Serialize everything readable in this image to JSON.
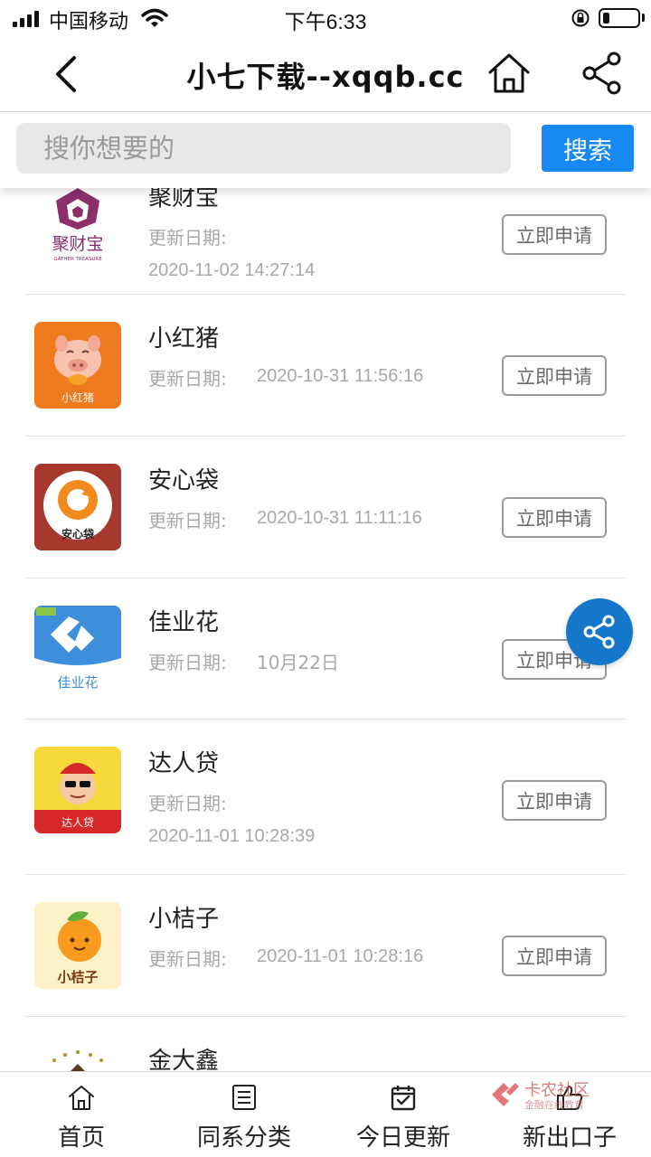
{
  "status_bar": {
    "carrier": "中国移动",
    "time": "下午6:33"
  },
  "nav": {
    "title": "小七下载--xqqb.cc",
    "back_icon": "chevron-left-icon",
    "home_icon": "home-icon",
    "share_icon": "share-icon"
  },
  "search": {
    "placeholder": "搜你想要的",
    "value": "",
    "button_label": "搜索"
  },
  "items": [
    {
      "name": "聚财宝",
      "date_label": "更新日期:",
      "date": "2020-11-02 14:27:14",
      "button": "立即申请",
      "icon_text": "聚财宝",
      "icon_subtext": "GATHER TREASURE"
    },
    {
      "name": "小红猪",
      "date_label": "更新日期:",
      "date": "2020-10-31 11:56:16",
      "button": "立即申请",
      "icon_text": "小红猪"
    },
    {
      "name": "安心袋",
      "date_label": "更新日期:",
      "date": "2020-10-31 11:11:16",
      "button": "立即申请",
      "icon_text": "安心袋"
    },
    {
      "name": "佳业花",
      "date_label": "更新日期:",
      "date": "10月22日",
      "button": "立即申请",
      "icon_text": "佳业花"
    },
    {
      "name": "达人贷",
      "date_label": "更新日期:",
      "date": "2020-11-01 10:28:39",
      "button": "立即申请",
      "icon_text": "达人贷"
    },
    {
      "name": "小桔子",
      "date_label": "更新日期:",
      "date": "2020-11-01 10:28:16",
      "button": "立即申请",
      "icon_text": "小桔子"
    },
    {
      "name": "金大鑫",
      "date_label": "",
      "date": "",
      "button": "",
      "icon_text": ""
    }
  ],
  "tabs": [
    {
      "label": "首页",
      "icon": "home-icon"
    },
    {
      "label": "同系分类",
      "icon": "list-icon"
    },
    {
      "label": "今日更新",
      "icon": "calendar-icon"
    },
    {
      "label": "新出口子",
      "icon": "thumbs-up-icon"
    }
  ],
  "watermark": {
    "title": "卡农社区",
    "subtitle": "金融在线教育"
  },
  "colors": {
    "accent": "#1888f2",
    "float_button": "#1477c9"
  }
}
